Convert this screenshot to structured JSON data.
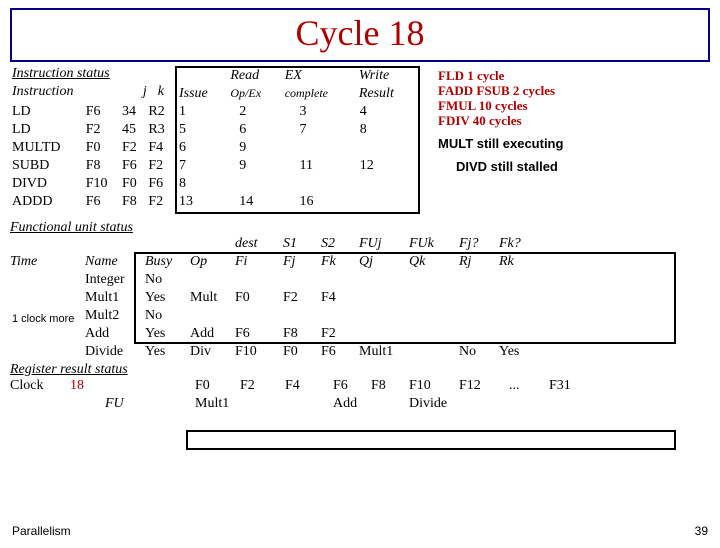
{
  "title": "Cycle 18",
  "instruction_status": {
    "label": "Instruction status",
    "col_instr": "Instruction",
    "col_j": "j",
    "col_k": "k",
    "col_issue": "Issue",
    "col_read": "Read",
    "col_opex": "Op/Ex",
    "col_ex": "EX",
    "col_complete": "complete",
    "col_write": "Write",
    "col_result": "Result",
    "rows": [
      {
        "i": "LD",
        "d": "F6",
        "j": "34",
        "k": "R2",
        "issue": "1",
        "read": "2",
        "ex": "3",
        "write": "4"
      },
      {
        "i": "LD",
        "d": "F2",
        "j": "45",
        "k": "R3",
        "issue": "5",
        "read": "6",
        "ex": "7",
        "write": "8"
      },
      {
        "i": "MULTD",
        "d": "F0",
        "j": "F2",
        "k": "F4",
        "issue": "6",
        "read": "9",
        "ex": "",
        "write": ""
      },
      {
        "i": "SUBD",
        "d": "F8",
        "j": "F6",
        "k": "F2",
        "issue": "7",
        "read": "9",
        "ex": "11",
        "write": "12"
      },
      {
        "i": "DIVD",
        "d": "F10",
        "j": "F0",
        "k": "F6",
        "issue": "8",
        "read": "",
        "ex": "",
        "write": ""
      },
      {
        "i": "ADDD",
        "d": "F6",
        "j": "F8",
        "k": "F2",
        "issue": "13",
        "read": "14",
        "ex": "16",
        "write": ""
      }
    ]
  },
  "latencies": {
    "l1": "FLD   1 cycle",
    "l2": "FADD FSUB 2 cycles",
    "l3": "FMUL 10 cycles",
    "l4": "FDIV  40 cycles"
  },
  "annotations": {
    "a1": "MULT still executing",
    "a2": "DIVD still stalled"
  },
  "fu_status": {
    "label": "Functional unit status",
    "h_time": "Time",
    "h_name": "Name",
    "h_busy": "Busy",
    "h_op": "Op",
    "h_dest": "dest",
    "h_fi": "Fi",
    "h_s1": "S1",
    "h_fj": "Fj",
    "h_s2": "S2",
    "h_fk": "Fk",
    "h_fuj": "FUj",
    "h_qj": "Qj",
    "h_fuk": "FUk",
    "h_qk": "Qk",
    "h_fjq": "Fj?",
    "h_rj": "Rj",
    "h_fkq": "Fk?",
    "h_rk": "Rk",
    "rows": [
      {
        "name": "Integer",
        "busy": "No",
        "op": "",
        "fi": "",
        "fj": "",
        "fk": "",
        "qj": "",
        "qk": "",
        "rj": "",
        "rk": ""
      },
      {
        "name": "Mult1",
        "busy": "Yes",
        "op": "Mult",
        "fi": "F0",
        "fj": "F2",
        "fk": "F4",
        "qj": "",
        "qk": "",
        "rj": "",
        "rk": ""
      },
      {
        "name": "Mult2",
        "busy": "No",
        "op": "",
        "fi": "",
        "fj": "",
        "fk": "",
        "qj": "",
        "qk": "",
        "rj": "",
        "rk": ""
      },
      {
        "name": "Add",
        "busy": "Yes",
        "op": "Add",
        "fi": "F6",
        "fj": "F8",
        "fk": "F2",
        "qj": "",
        "qk": "",
        "rj": "",
        "rk": ""
      },
      {
        "name": "Divide",
        "busy": "Yes",
        "op": "Div",
        "fi": "F10",
        "fj": "F0",
        "fk": "F6",
        "qj": "Mult1",
        "qk": "",
        "rj": "No",
        "rk": "Yes"
      }
    ]
  },
  "clock_note": "1 clock more",
  "reg_status": {
    "label": "Register result status",
    "clock_label": "Clock",
    "clock_val": "18",
    "fu_label": "FU",
    "regs": [
      "F0",
      "F2",
      "F4",
      "F6",
      "F8",
      "F10",
      "F12",
      "...",
      "F31"
    ],
    "fu": [
      "Mult1",
      "",
      "",
      "Add",
      "",
      "Divide",
      "",
      "",
      ""
    ]
  },
  "footer": {
    "left": "Parallelism",
    "right": "39"
  }
}
